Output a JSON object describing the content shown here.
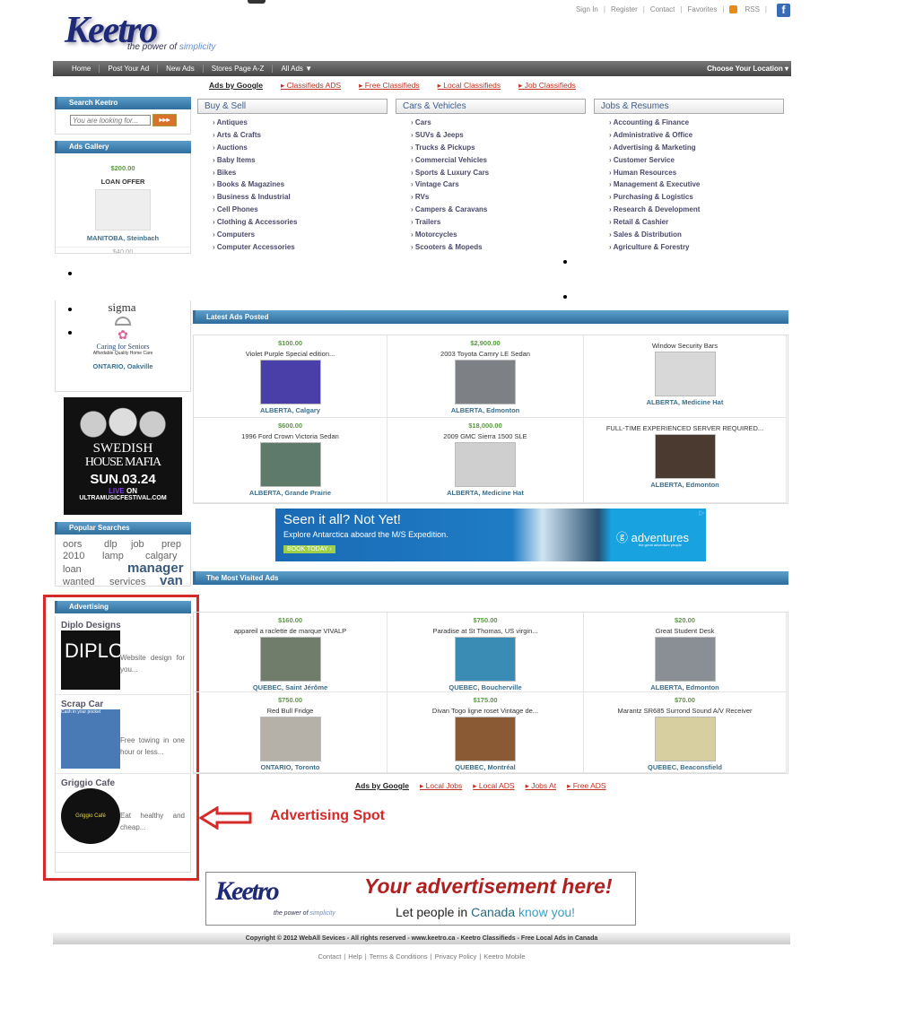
{
  "header": {
    "logo_text": "Keetro",
    "logo_tagline_a": "the power of",
    "logo_tagline_b": "simplicity",
    "top_links": [
      "Sign In",
      "Register",
      "Contact",
      "Favorites",
      "RSS"
    ],
    "facebook_icon": "facebook-icon"
  },
  "nav": {
    "items": [
      "Home",
      "Post Your Ad",
      "New Ads",
      "Stores Page A-Z",
      "All Ads ▼"
    ],
    "location": "Choose Your Location ▾"
  },
  "google_links_top": {
    "label": "Ads by Google",
    "links": [
      "▸ Classifieds ADS",
      "▸ Free Classifieds",
      "▸ Local Classifieds",
      "▸ Job Classifieds"
    ]
  },
  "sidebar": {
    "search": {
      "title": "Search Keetro",
      "placeholder": "You are looking for...",
      "button": "▸▸▸"
    },
    "gallery": {
      "title": "Ads Gallery",
      "price": "$200.00",
      "item": "LOAN OFFER",
      "location": "MANITOBA, Steinbach",
      "next_price": "$40.00",
      "sigma_logo": "sigma",
      "caring_title": "Caring for Seniors",
      "caring_sub": "Affordable Quality Home Care",
      "location2": "ONTARIO, Oakville"
    },
    "banner": {
      "line1": "SWEDISH",
      "line2": "HOUSE MAFIA",
      "line3": "SUN.03.24",
      "live": "LIVE",
      "on": "ON",
      "site": "ULTRAMUSICFESTIVAL.COM"
    },
    "popular": {
      "title": "Popular Searches",
      "words": [
        "oors",
        "dlp",
        "job",
        "prep",
        "2010",
        "lamp",
        "calgary",
        "loan",
        "manager",
        "wanted",
        "services",
        "van"
      ]
    },
    "advertising": {
      "title": "Advertising",
      "items": [
        {
          "name": "Diplo Designs",
          "logo": "DIPLO",
          "desc": "Website design for you..."
        },
        {
          "name": "Scrap Car",
          "logo": "Cash in your pocket",
          "desc": "Free towing in one hour or less..."
        },
        {
          "name": "Griggio Cafe",
          "logo": "Griggio Café",
          "desc": "Eat healthy and cheap..."
        }
      ]
    }
  },
  "categories": [
    {
      "title": "Buy & Sell",
      "items": [
        "Antiques",
        "Arts & Crafts",
        "Auctions",
        "Baby Items",
        "Bikes",
        "Books & Magazines",
        "Business & Industrial",
        "Cell Phones",
        "Clothing & Accessories",
        "Computers",
        "Computer Accessories"
      ]
    },
    {
      "title": "Cars & Vehicles",
      "items": [
        "Cars",
        "SUVs & Jeeps",
        "Trucks & Pickups",
        "Commercial Vehicles",
        "Sports & Luxury Cars",
        "Vintage Cars",
        "RVs",
        "Campers & Caravans",
        "Trailers",
        "Motorcycles",
        "Scooters & Mopeds"
      ]
    },
    {
      "title": "Jobs & Resumes",
      "items": [
        "Accounting & Finance",
        "Administrative & Office",
        "Advertising & Marketing",
        "Customer Service",
        "Human Resources",
        "Management & Executive",
        "Purchasing & Logistics",
        "Research & Development",
        "Retail & Cashier",
        "Sales & Distribution",
        "Agriculture & Forestry"
      ]
    }
  ],
  "latest": {
    "title": "Latest Ads Posted",
    "ads": [
      {
        "price": "$100.00",
        "title": "Violet Purple Special edition...",
        "location": "ALBERTA, Calgary",
        "color": "#4a3fa8"
      },
      {
        "price": "$2,900.00",
        "title": "2003 Toyota Camry LE Sedan",
        "location": "ALBERTA, Edmonton",
        "color": "#7d8084"
      },
      {
        "price": "",
        "title": "Window Security Bars",
        "location": "ALBERTA, Medicine Hat",
        "color": "#d8d8d8"
      },
      {
        "price": "$600.00",
        "title": "1996 Ford Crown Victoria Sedan",
        "location": "ALBERTA, Grande Prairie",
        "color": "#5d7a6a"
      },
      {
        "price": "$18,000.00",
        "title": "2009 GMC Sierra 1500 SLE",
        "location": "ALBERTA, Medicine Hat",
        "color": "#cfcfcf"
      },
      {
        "price": "",
        "title": "FULL-TIME EXPERIENCED SERVER REQUIRED...",
        "location": "ALBERTA, Edmonton",
        "color": "#4a3a30"
      }
    ]
  },
  "banner_ad": {
    "headline": "Seen it all? Not Yet!",
    "sub": "Explore Antarctica aboard the M/S Expedition.",
    "cta": "BOOK TODAY ›",
    "brand": "adventures",
    "brand_sub": "the great adventure people"
  },
  "visited": {
    "title": "The Most Visited Ads",
    "ads": [
      {
        "price": "$160.00",
        "title": "appareil a raclette de marque VIVALP",
        "location": "QUEBEC, Saint Jérôme",
        "color": "#6f7d6a"
      },
      {
        "price": "$750.00",
        "title": "Paradise at St Thomas, US virgin...",
        "location": "QUEBEC, Boucherville",
        "color": "#3a8cb5"
      },
      {
        "price": "$20.00",
        "title": "Great Student Desk",
        "location": "ALBERTA, Edmonton",
        "color": "#8a8f95"
      },
      {
        "price": "$750.00",
        "title": "Red Bull Fridge",
        "location": "ONTARIO, Toronto",
        "color": "#b5b0a8"
      },
      {
        "price": "$175.00",
        "title": "Divan Togo ligne roset Vintage de...",
        "location": "QUEBEC, Montréal",
        "color": "#8a5a35"
      },
      {
        "price": "$70.00",
        "title": "Marantz SR685 Surrond Sound A/V Receiver",
        "location": "QUEBEC, Beaconsfield",
        "color": "#d8cfa0"
      }
    ]
  },
  "google_links_bottom": {
    "label": "Ads by Google",
    "links": [
      "▸ Local Jobs",
      "▸ Local ADS",
      "▸ Jobs At",
      "▸ Free ADS"
    ]
  },
  "annotation": {
    "label": "Advertising Spot",
    "color": "#d42a2a"
  },
  "promo": {
    "logo": "Keetro",
    "tag_a": "the power of",
    "tag_b": "simplicity",
    "headline": "Your advertisement here!",
    "sub_a": "Let people in",
    "sub_b": "Canada",
    "sub_c": "know you!"
  },
  "footer": {
    "copyright": "Copyright © 2012 WebAll Sevices - All rights reserved - www.keetro.ca - Keetro Classifieds - Free Local Ads in Canada",
    "links": [
      "Contact",
      "Help",
      "Terms & Conditions",
      "Privacy Policy",
      "Keetro Mobile"
    ]
  }
}
